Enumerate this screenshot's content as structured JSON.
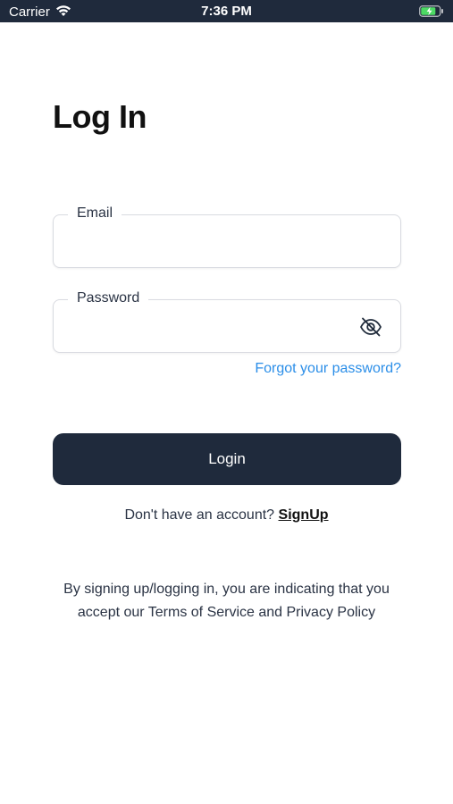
{
  "status_bar": {
    "carrier": "Carrier",
    "time": "7:36 PM",
    "icons": [
      "wifi-icon",
      "battery-charging-icon"
    ]
  },
  "page": {
    "title": "Log In"
  },
  "form": {
    "email": {
      "label": "Email",
      "value": "",
      "placeholder": ""
    },
    "password": {
      "label": "Password",
      "value": "",
      "placeholder": "",
      "toggle_icon": "eye-off-icon"
    },
    "forgot_label": "Forgot your password?",
    "login_label": "Login"
  },
  "signup": {
    "prompt": "Don't have an account?",
    "link_label": "SignUp"
  },
  "terms_text": "By signing up/logging in, you are indicating that you accept our Terms of Service and Privacy Policy",
  "colors": {
    "primary": "#1f2a3c",
    "link": "#2b8ee8",
    "battery": "#4cd964"
  }
}
